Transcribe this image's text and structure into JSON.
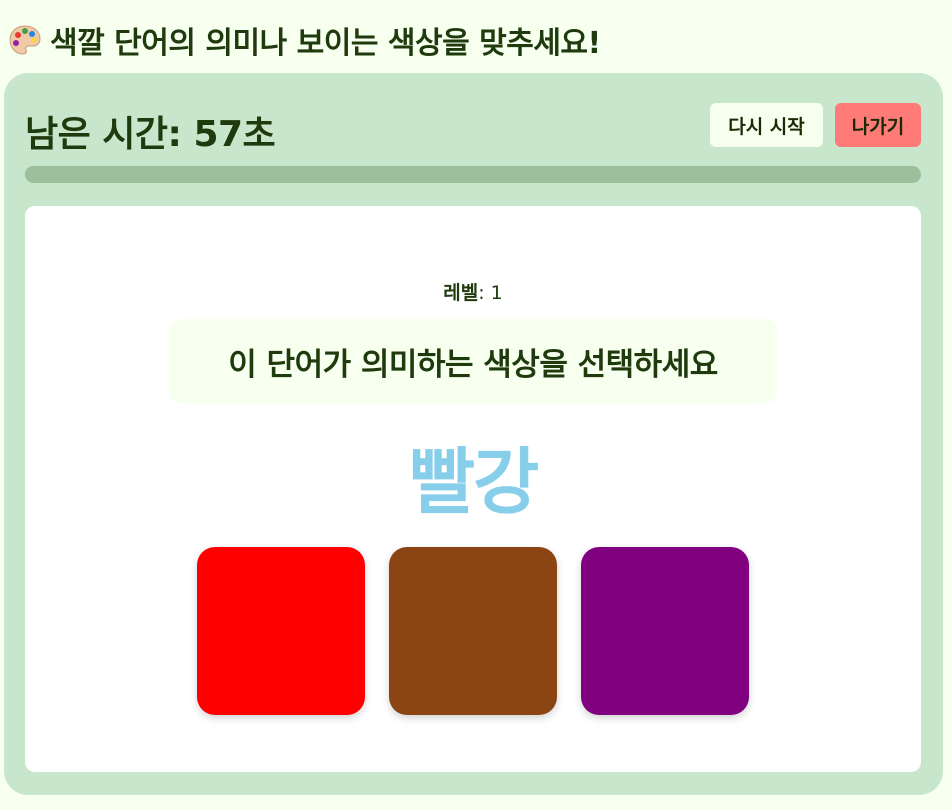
{
  "header": {
    "icon": "palette-icon",
    "title": "색깔 단어의 의미나 보이는 색상을 맞추세요!"
  },
  "timer": {
    "label": "남은 시간: 57초",
    "seconds_remaining": 57
  },
  "controls": {
    "restart_label": "다시 시작",
    "exit_label": "나가기"
  },
  "progress": {
    "fraction": 0.95
  },
  "game": {
    "level_label": "레벨",
    "level_value": ": 1",
    "instruction": "이 단어가 의미하는 색상을 선택하세요",
    "word": "빨강",
    "word_color": "#87ceeb",
    "options": [
      {
        "color": "#ff0000"
      },
      {
        "color": "#8b4513"
      },
      {
        "color": "#800080"
      }
    ]
  },
  "colors": {
    "background": "#f7ffee",
    "panel": "#c8e6cc",
    "progress_track": "#9dbf9b",
    "restart_button": "#f7ffee",
    "exit_button": "#ff7b78",
    "text": "#1f3a0d"
  }
}
